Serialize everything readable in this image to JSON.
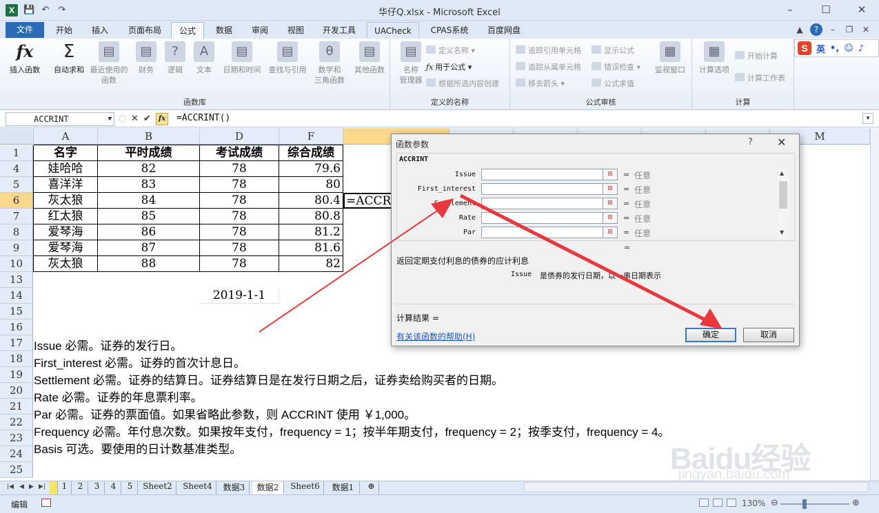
{
  "window": {
    "title": "华仔Q.xlsx - Microsoft Excel",
    "app_icon": "X"
  },
  "qat": {
    "save_icon": "💾",
    "undo_icon": "↶",
    "redo_icon": "↷"
  },
  "ribbon_tabs": [
    "文件",
    "开始",
    "插入",
    "页面布局",
    "公式",
    "数据",
    "审阅",
    "视图",
    "开发工具",
    "UACheck",
    "CPAS系统",
    "百度网盘"
  ],
  "ribbon": {
    "function_library": {
      "label": "函数库",
      "buttons": [
        {
          "label": "插入函数",
          "icon": "fx"
        },
        {
          "label": "自动求和",
          "icon": "Σ"
        },
        {
          "label": "最近使用的\n函数",
          "icon": "▤"
        },
        {
          "label": "财务",
          "icon": "▤"
        },
        {
          "label": "逻辑",
          "icon": "?"
        },
        {
          "label": "文本",
          "icon": "A"
        },
        {
          "label": "日期和时间",
          "icon": "▤"
        },
        {
          "label": "查找与引用",
          "icon": "▤"
        },
        {
          "label": "数学和\n三角函数",
          "icon": "θ"
        },
        {
          "label": "其他函数",
          "icon": "▤"
        }
      ]
    },
    "defined_names": {
      "label": "定义的名称",
      "name_manager": "名称\n管理器",
      "define_name": "定义名称",
      "use_in_formula": "用于公式",
      "create_from_selection": "根据所选内容创建"
    },
    "formula_auditing": {
      "label": "公式审核",
      "trace_precedents": "追踪引用单元格",
      "trace_dependents": "追踪从属单元格",
      "remove_arrows": "移去箭头",
      "show_formulas": "显示公式",
      "error_checking": "错误检查",
      "evaluate_formula": "公式求值",
      "watch_window": "监视窗口"
    },
    "calculation": {
      "label": "计算",
      "options": "计算选项",
      "calc_now": "开始计算",
      "calc_sheet": "计算工作表"
    }
  },
  "ime": {
    "logo": "S",
    "mode": "英"
  },
  "formula_bar": {
    "name_box": "ACCRINT",
    "formula": "=ACCRINT()",
    "fx_label": "fx"
  },
  "grid": {
    "columns": [
      "A",
      "B",
      "D",
      "F",
      "",
      "",
      "",
      "",
      "",
      "",
      "M"
    ],
    "row_numbers": [
      "1",
      "4",
      "5",
      "6",
      "7",
      "8",
      "9",
      "10",
      "13",
      "14",
      "15",
      "16",
      "17",
      "18",
      "19",
      "20",
      "21",
      "22",
      "23",
      "24",
      "25"
    ],
    "headers": [
      "名字",
      "平时成绩",
      "考试成绩",
      "综合成绩"
    ],
    "rows": [
      [
        "娃哈哈",
        "82",
        "78",
        "79.6"
      ],
      [
        "喜洋洋",
        "83",
        "78",
        "80"
      ],
      [
        "灰太狼",
        "84",
        "78",
        "80.4"
      ],
      [
        "红太狼",
        "85",
        "78",
        "80.8"
      ],
      [
        "爱琴海",
        "86",
        "78",
        "81.2"
      ],
      [
        "爱琴海",
        "87",
        "78",
        "81.6"
      ],
      [
        "灰太狼",
        "88",
        "78",
        "82"
      ]
    ],
    "active_cell_text": "=ACCRIN",
    "date_cell": "2019-1-1",
    "notes": [
      "Issue 必需。证券的发行日。",
      "First_interest 必需。证券的首次计息日。",
      "Settlement 必需。证券的结算日。证券结算日是在发行日期之后，证券卖给购买者的日期。",
      "Rate 必需。证券的年息票利率。",
      "Par 必需。证券的票面值。如果省略此参数，则 ACCRINT 使用 ￥1,000。",
      "Frequency 必需。年付息次数。如果按年支付，frequency = 1；按半年期支付，frequency = 2；按季支付，frequency = 4。",
      "Basis 可选。要使用的日计数基准类型。"
    ]
  },
  "sheet_tabs": [
    "1",
    "2",
    "3",
    "4",
    "5",
    "Sheet2",
    "Sheet4",
    "数据3",
    "数据2",
    "Sheet6",
    "数据1"
  ],
  "active_sheet": "数据2",
  "status": {
    "mode": "编辑",
    "zoom": "130%"
  },
  "dialog": {
    "title": "函数参数",
    "help_glyph": "?",
    "close_glyph": "✕",
    "function_name": "ACCRINT",
    "args": [
      {
        "name": "Issue",
        "value": "任意"
      },
      {
        "name": "First_interest",
        "value": "任意"
      },
      {
        "name": "Settlement",
        "value": "任意"
      },
      {
        "name": "Rate",
        "value": "任意"
      },
      {
        "name": "Par",
        "value": "任意"
      }
    ],
    "equals": "=",
    "description": "返回定期支付利息的债券的应计利息",
    "arg_help_name": "Issue",
    "arg_help_text": "是债券的发行日期，以一串日期表示",
    "result_label": "计算结果 =",
    "help_link": "有关该函数的帮助(H)",
    "ok": "确定",
    "cancel": "取消"
  },
  "watermark": {
    "logo": "Baidu经验",
    "url": "jingyan.baidu.com"
  },
  "colors": {
    "arrow": "#e8383d",
    "accent": "#2a6bb8",
    "selected_header": "#f9d98b"
  }
}
